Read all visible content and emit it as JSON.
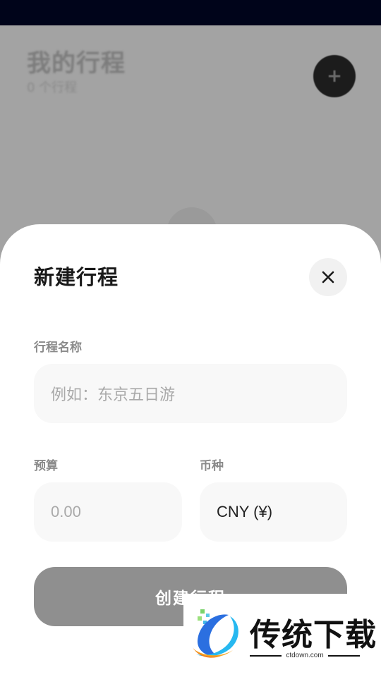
{
  "background": {
    "title": "我的行程",
    "subtitle": "0 个行程",
    "add_icon": "plus-icon"
  },
  "sheet": {
    "title": "新建行程",
    "close_icon": "close-icon",
    "name_label": "行程名称",
    "name_placeholder": "例如：东京五日游",
    "budget_label": "预算",
    "budget_placeholder": "0.00",
    "currency_label": "币种",
    "currency_value": "CNY (¥)",
    "create_label": "创建行程"
  },
  "watermark": {
    "text": "传统下载",
    "url": "ctdown.com"
  },
  "colors": {
    "status_bar": "#00041a",
    "overlay": "#a3a3a3",
    "sheet_bg": "#ffffff",
    "input_bg": "#f8f8f8",
    "button_disabled": "#8f8f8f"
  }
}
